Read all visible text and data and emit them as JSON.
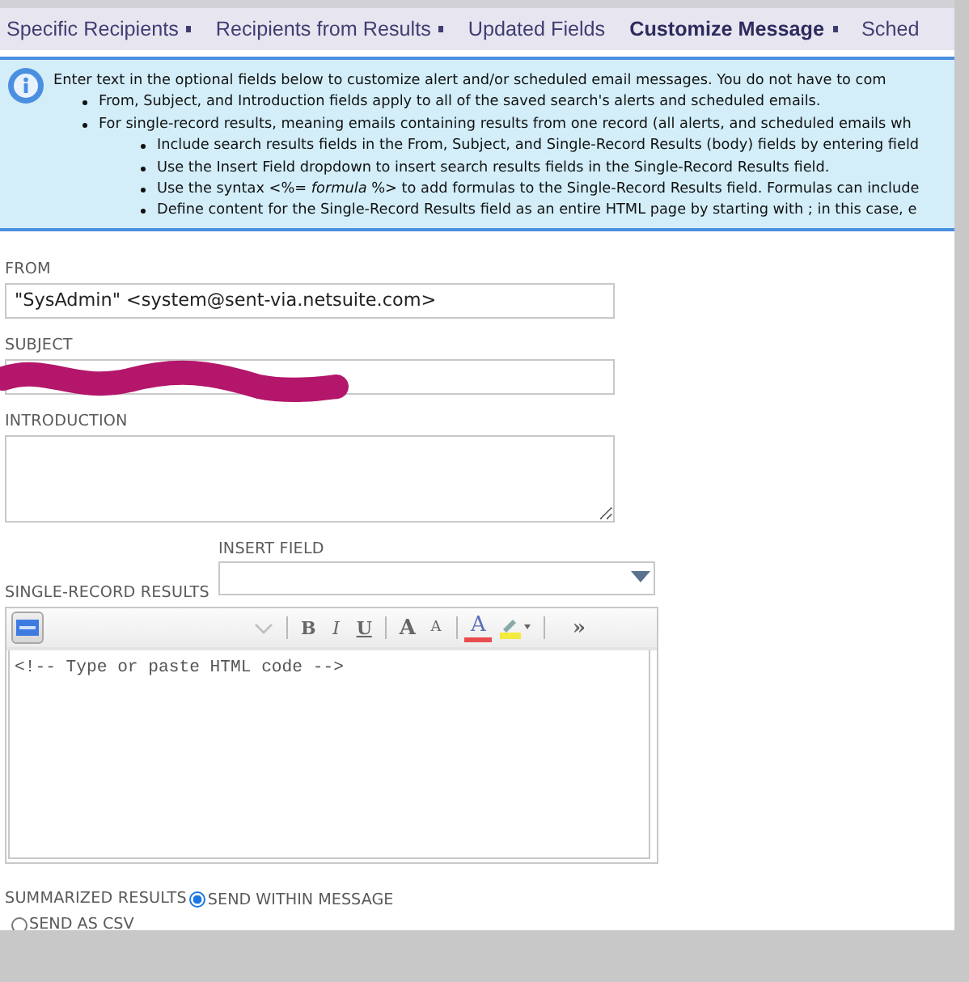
{
  "tabs": [
    {
      "label": "Specific Recipients",
      "marked": true,
      "selected": false
    },
    {
      "label": "Recipients from Results",
      "marked": true,
      "selected": false
    },
    {
      "label": "Updated Fields",
      "marked": false,
      "selected": false
    },
    {
      "label": "Customize Message",
      "marked": true,
      "selected": true
    },
    {
      "label": "Sched",
      "marked": false,
      "selected": false
    }
  ],
  "info": {
    "intro": "Enter text in the optional fields below to customize alert and/or scheduled email messages. You do not have to com",
    "bullets": [
      {
        "text": "From, Subject, and Introduction fields apply to all of the saved search's alerts and scheduled emails."
      },
      {
        "text": "For single-record results, meaning emails containing results from one record (all alerts, and scheduled emails wh",
        "children": [
          {
            "text": "Include search results fields in the From, Subject, and Single-Record Results (body) fields by entering field"
          },
          {
            "text": "Use the Insert Field dropdown to insert search results fields in the Single-Record Results field."
          },
          {
            "text": "Use the syntax <%= *formula* %> to add formulas to the Single-Record Results field. Formulas can include"
          },
          {
            "text": "Define content for the Single-Record Results field as an entire HTML page by starting with ; in this case, e"
          }
        ]
      }
    ]
  },
  "from": {
    "label": "FROM",
    "value": "\"SysAdmin\" <system@sent-via.netsuite.com>"
  },
  "subject": {
    "label": "SUBJECT",
    "redacted": true
  },
  "introduction": {
    "label": "INTRODUCTION"
  },
  "single_record_results": {
    "label": "SINGLE-RECORD RESULTS",
    "insert_field": {
      "label": "INSERT FIELD"
    },
    "toolbar": [
      {
        "kind": "html"
      },
      {
        "kind": "dropdown",
        "disabled": true
      },
      {
        "kind": "separator"
      },
      {
        "kind": "bold",
        "text": "B"
      },
      {
        "kind": "italic",
        "text": "I"
      },
      {
        "kind": "underline",
        "text": "U"
      },
      {
        "kind": "separator"
      },
      {
        "kind": "grow",
        "text": "A"
      },
      {
        "kind": "shrink",
        "text": "A"
      },
      {
        "kind": "separator"
      },
      {
        "kind": "fontcolor",
        "text": "A",
        "color": "#e84c4c"
      },
      {
        "kind": "highlight",
        "color": "#f2ea3c"
      },
      {
        "kind": "separator"
      },
      {
        "kind": "more",
        "text": "»"
      }
    ],
    "content": "<!-- Type or paste HTML code -->"
  },
  "summarized_results": {
    "label": "SUMMARIZED RESULTS",
    "options": [
      {
        "label": "SEND WITHIN MESSAGE",
        "selected": true
      },
      {
        "label": "SEND AS CSV",
        "selected": false
      }
    ]
  }
}
